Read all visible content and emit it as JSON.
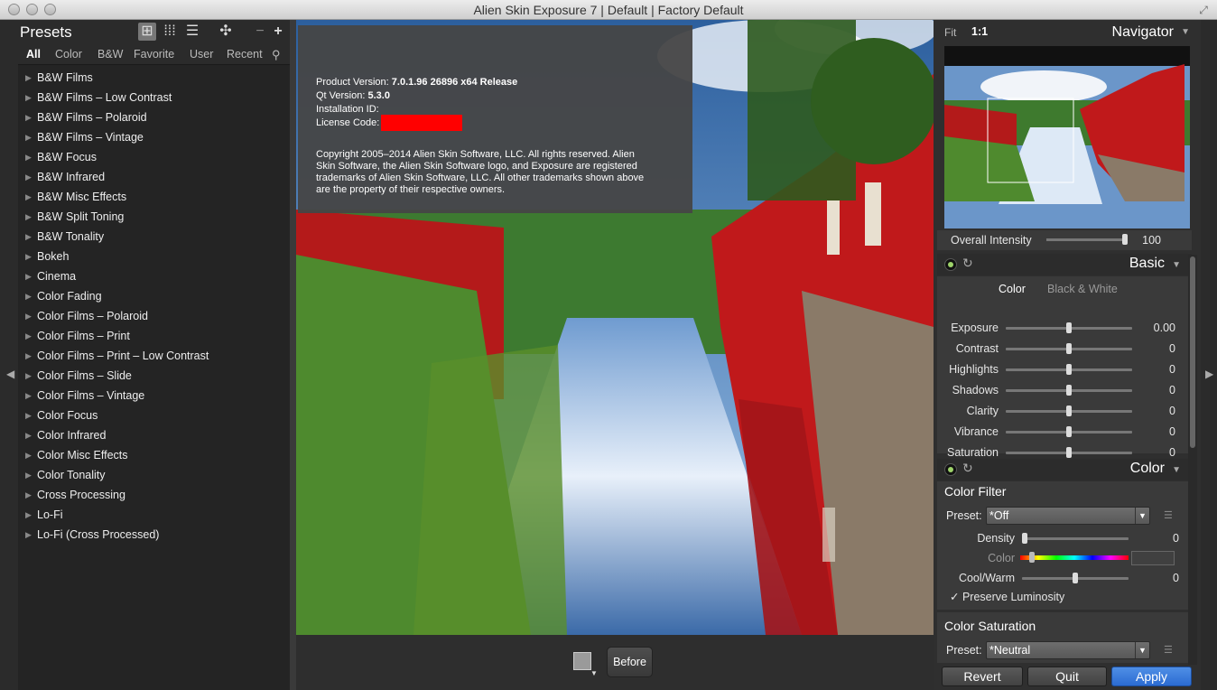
{
  "window": {
    "title": "Alien Skin Exposure 7 | Default | Factory Default"
  },
  "presets": {
    "title": "Presets",
    "filters": [
      "All",
      "Color",
      "B&W",
      "Favorite",
      "User",
      "Recent"
    ],
    "items": [
      "B&W Films",
      "B&W Films – Low Contrast",
      "B&W Films – Polaroid",
      "B&W Films – Vintage",
      "B&W Focus",
      "B&W Infrared",
      "B&W Misc Effects",
      "B&W Split Toning",
      "B&W Tonality",
      "Bokeh",
      "Cinema",
      "Color Fading",
      "Color Films – Polaroid",
      "Color Films – Print",
      "Color Films – Print – Low Contrast",
      "Color Films – Slide",
      "Color Films – Vintage",
      "Color Focus",
      "Color Infrared",
      "Color Misc Effects",
      "Color Tonality",
      "Cross Processing",
      "Lo-Fi",
      "Lo-Fi (Cross Processed)"
    ]
  },
  "about": {
    "product_label": "Product Version:",
    "product_value": "7.0.1.96 26896 x64 Release",
    "qt_label": "Qt Version:",
    "qt_value": "5.3.0",
    "install_label": "Installation ID:",
    "license_label": "License Code:",
    "copyright1": "Copyright 2005–2014 Alien Skin Software, LLC. All rights reserved. Alien",
    "copyright2": "Skin Software, the Alien Skin Software logo, and Exposure are registered",
    "copyright3": "trademarks of Alien Skin Software, LLC. All other trademarks shown above",
    "copyright4": "are the property of their respective owners."
  },
  "bottom": {
    "before_label": "Before"
  },
  "navigator": {
    "fit": "Fit",
    "one_to_one": "1:1",
    "title": "Navigator"
  },
  "intensity": {
    "label": "Overall Intensity",
    "value": "100",
    "level": 1.0
  },
  "basic": {
    "title": "Basic",
    "tab_color": "Color",
    "tab_bw": "Black & White",
    "sliders": [
      {
        "label": "Exposure",
        "value": "0.00",
        "level": 0.5
      },
      {
        "label": "Contrast",
        "value": "0",
        "level": 0.5
      },
      {
        "label": "Highlights",
        "value": "0",
        "level": 0.5
      },
      {
        "label": "Shadows",
        "value": "0",
        "level": 0.5
      },
      {
        "label": "Clarity",
        "value": "0",
        "level": 0.5
      },
      {
        "label": "Vibrance",
        "value": "0",
        "level": 0.5
      },
      {
        "label": "Saturation",
        "value": "0",
        "level": 0.5
      }
    ]
  },
  "color": {
    "title": "Color",
    "filter_title": "Color Filter",
    "preset_label": "Preset:",
    "filter_preset": "*Off",
    "density_label": "Density",
    "density_value": "0",
    "density_level": 0.0,
    "color_label": "Color",
    "coolwarm_label": "Cool/Warm",
    "coolwarm_value": "0",
    "coolwarm_level": 0.5,
    "preserve_label": "Preserve Luminosity",
    "saturation_title": "Color Saturation",
    "saturation_preset": "*Neutral"
  },
  "footer": {
    "revert": "Revert",
    "quit": "Quit",
    "apply": "Apply"
  },
  "colors": {
    "accent": "#2b6bd1",
    "redacted": "#ff0000",
    "active_dot": "#9ed36a"
  }
}
